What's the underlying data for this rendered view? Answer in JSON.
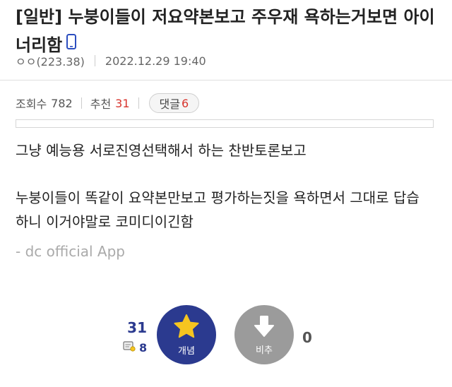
{
  "post": {
    "title": "[일반] 누붕이들이 저요약본보고 주우재 욕하는거보면 아이너리함",
    "author": "ㅇㅇ(223.38)",
    "date": "2022.12.29 19:40"
  },
  "stats": {
    "views_label": "조회수",
    "views": "782",
    "recommend_label": "추천",
    "recommend": "31",
    "comment_label": "댓글",
    "comments": "6"
  },
  "body": {
    "line1": "그냥 예능용 서로진영선택해서 하는 찬반토론보고",
    "line2": "누붕이들이 똑같이 요약본만보고 평가하는짓을 욕하면서 그대로 답습",
    "line3": "하니 이거야말로 코미디이긴함",
    "app_tag": "- dc official App"
  },
  "vote": {
    "recommend_count": "31",
    "fixed_count": "8",
    "up_label": "개념",
    "down_label": "비추",
    "down_count": "0"
  },
  "colors": {
    "accent": "#2b3a8f",
    "red": "#d8342d",
    "star": "#f6c520",
    "down_button": "#9b9b9b"
  },
  "icons": {
    "title_icon": "mobile-phone-icon",
    "up_icon": "star-icon",
    "down_icon": "down-arrow-icon",
    "fixed_icon": "fixed-count-icon"
  }
}
